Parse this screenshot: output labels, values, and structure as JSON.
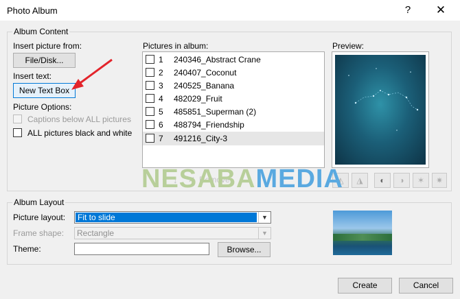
{
  "window": {
    "title": "Photo Album",
    "help_glyph": "?",
    "close_glyph": "✕"
  },
  "album_content": {
    "group_label": "Album Content",
    "insert_picture_from": "Insert picture from:",
    "file_disk_button": "File/Disk...",
    "insert_text": "Insert text:",
    "new_text_box_button": "New Text Box",
    "picture_options": "Picture Options:",
    "captions_below": "Captions below ALL pictures",
    "all_black_white": "ALL pictures black and white",
    "pictures_in_album_label": "Pictures in album:",
    "pictures": [
      {
        "num": "1",
        "name": "240346_Abstract Crane"
      },
      {
        "num": "2",
        "name": "240407_Coconut"
      },
      {
        "num": "3",
        "name": "240525_Banana"
      },
      {
        "num": "4",
        "name": "482029_Fruit"
      },
      {
        "num": "5",
        "name": "485851_Superman (2)"
      },
      {
        "num": "6",
        "name": "488794_Friendship"
      },
      {
        "num": "7",
        "name": "491216_City-3"
      }
    ],
    "selected_index": 6,
    "preview_label": "Preview:",
    "remove_label": "Remove"
  },
  "watermark": {
    "part1": "NESABA",
    "part2": "MEDIA",
    "color1": "#b8cf9a",
    "color2": "#5aa9e0"
  },
  "album_layout": {
    "group_label": "Album Layout",
    "picture_layout_label": "Picture layout:",
    "picture_layout_value": "Fit to slide",
    "frame_shape_label": "Frame shape:",
    "frame_shape_value": "Rectangle",
    "theme_label": "Theme:",
    "theme_value": "",
    "browse_button": "Browse..."
  },
  "footer": {
    "create_button": "Create",
    "cancel_button": "Cancel"
  },
  "colors": {
    "selection_blue": "#0078d7",
    "annotation_arrow": "#e3242b"
  }
}
